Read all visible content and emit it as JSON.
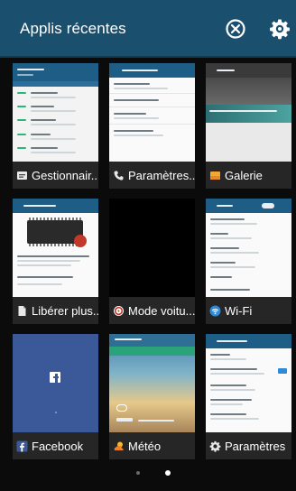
{
  "header": {
    "title": "Applis récentes",
    "background": "#1b4f6e"
  },
  "cards": [
    {
      "label": "Gestionnair...",
      "icon": "message-icon"
    },
    {
      "label": "Paramètres...",
      "icon": "phone-icon"
    },
    {
      "label": "Galerie",
      "icon": "gallery-icon"
    },
    {
      "label": "Libérer plus...",
      "icon": "file-icon"
    },
    {
      "label": "Mode voitu...",
      "icon": "car-mode-icon"
    },
    {
      "label": "Wi-Fi",
      "icon": "wifi-icon"
    },
    {
      "label": "Facebook",
      "icon": "facebook-icon"
    },
    {
      "label": "Météo",
      "icon": "weather-icon"
    },
    {
      "label": "Paramètres",
      "icon": "settings-icon"
    }
  ],
  "pager": {
    "pages": 2,
    "current": 2
  }
}
